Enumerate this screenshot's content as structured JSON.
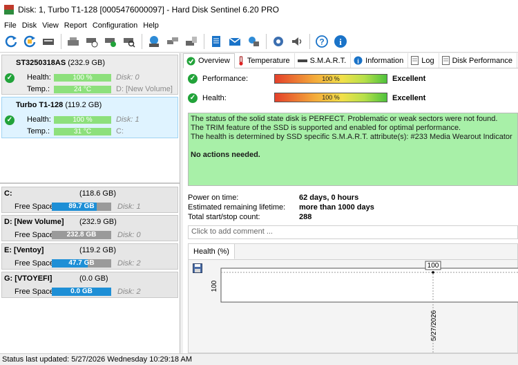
{
  "window": {
    "title": "Disk: 1, Turbo T1-128 [0005476000097]  -  Hard Disk Sentinel 6.20 PRO"
  },
  "menu": [
    "File",
    "Disk",
    "View",
    "Report",
    "Configuration",
    "Help"
  ],
  "toolbar": {
    "icons": [
      "refresh-icon",
      "refresh-all-icon",
      "disk-icon",
      "disk-tools-icon",
      "schedule-icon",
      "test-icon",
      "surface-scan-icon",
      "network-disk-icon",
      "transfer-icon",
      "disk-report-icon",
      "notes-icon",
      "email-icon",
      "network-icon",
      "settings-icon",
      "sound-icon",
      "help-icon",
      "info-icon"
    ]
  },
  "disks": [
    {
      "name": "ST3250318AS",
      "size": "(232.9 GB)",
      "health_label": "Health:",
      "health": "100 %",
      "health_level": 100,
      "disk_info": "Disk: 0",
      "temp_label": "Temp.:",
      "temp": "24 °C",
      "volume_info": "D: [New Volume]"
    },
    {
      "name": "Turbo T1-128",
      "size": "(119.2 GB)",
      "health_label": "Health:",
      "health": "100 %",
      "health_level": 100,
      "disk_info": "Disk: 1",
      "temp_label": "Temp.:",
      "temp": "31 °C",
      "volume_info": "C:"
    }
  ],
  "volumes": [
    {
      "name": "C:",
      "size": "(118.6 GB)",
      "free_label": "Free Space",
      "free": "89.7 GB",
      "free_fraction": 0.76,
      "disk": "Disk: 1"
    },
    {
      "name": "D: [New Volume]",
      "size": "(232.9 GB)",
      "free_label": "Free Space",
      "free": "232.8 GB",
      "free_fraction": 0.0,
      "disk": "Disk: 0"
    },
    {
      "name": "E: [Ventoy]",
      "size": "(119.2 GB)",
      "free_label": "Free Space",
      "free": "47.7 GB",
      "free_fraction": 0.6,
      "disk": "Disk: 2"
    },
    {
      "name": "G: [VTOYEFI]",
      "size": "(0.0 GB)",
      "free_label": "Free Space",
      "free": "0.0 GB",
      "free_fraction": 1.0,
      "disk": "Disk: 2"
    }
  ],
  "tabs": [
    "Overview",
    "Temperature",
    "S.M.A.R.T.",
    "Information",
    "Log",
    "Disk Performance"
  ],
  "overview": {
    "performance_label": "Performance:",
    "performance_value": "100 %",
    "performance_rating": "Excellent",
    "health_label": "Health:",
    "health_value": "100 %",
    "health_rating": "Excellent",
    "status_lines": [
      "The status of the solid state disk is PERFECT. Problematic or weak sectors were not found.",
      "The TRIM feature of the SSD is supported and enabled for optimal performance.",
      "The health is determined by SSD specific S.M.A.R.T. attribute(s):  #233 Media Wearout Indicator"
    ],
    "action": "No actions needed.",
    "power_on_label": "Power on time:",
    "power_on_value": "62 days, 0 hours",
    "lifetime_label": "Estimated remaining lifetime:",
    "lifetime_value": "more than 1000 days",
    "startstop_label": "Total start/stop count:",
    "startstop_value": "288",
    "comment_placeholder": "Click to add comment ..."
  },
  "health_chart": {
    "tab_label": "Health (%)",
    "y_tick": "100",
    "x_tick": "5/27/2026",
    "point_label": "100"
  },
  "chart_data": {
    "type": "line",
    "x": [
      "5/27/2026"
    ],
    "series": [
      {
        "values": [
          100
        ]
      }
    ],
    "title": "Health (%)",
    "ylim": [
      0,
      100
    ]
  },
  "statusbar": {
    "text": "Status last updated: 5/27/2026 Wednesday 10:29:18 AM"
  },
  "colors": {
    "ok_green": "#22a33a",
    "status_bg": "#a8f0a8",
    "free_space_blue": "#1e8fd6",
    "selected_disk_bg": "#dff3ff"
  }
}
